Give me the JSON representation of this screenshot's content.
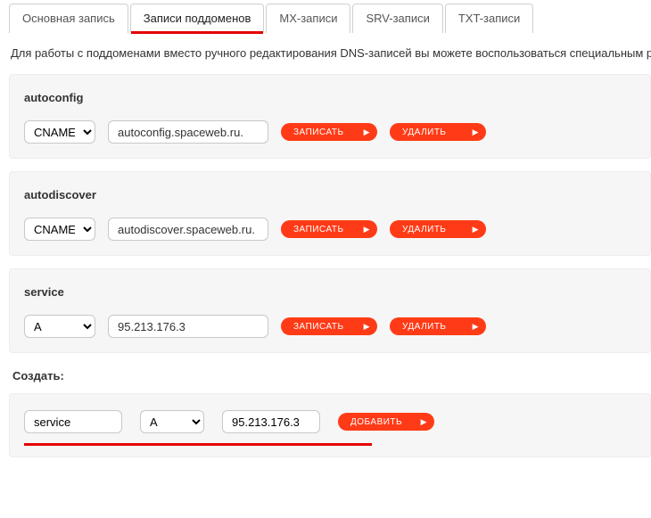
{
  "tabs": {
    "main": "Основная запись",
    "subdomains": "Записи поддоменов",
    "mx": "MX-записи",
    "srv": "SRV-записи",
    "txt": "TXT-записи"
  },
  "description": "Для работы с поддоменами вместо ручного редактирования DNS-записей вы можете воспользоваться специальным ра",
  "buttons": {
    "save": "ЗАПИСАТЬ",
    "delete": "УДАЛИТЬ",
    "add": "ДОБАВИТЬ"
  },
  "record_types": [
    "A",
    "CNAME"
  ],
  "records": [
    {
      "name": "autoconfig",
      "type": "CNAME",
      "value": "autoconfig.spaceweb.ru."
    },
    {
      "name": "autodiscover",
      "type": "CNAME",
      "value": "autodiscover.spaceweb.ru."
    },
    {
      "name": "service",
      "type": "A",
      "value": "95.213.176.3"
    }
  ],
  "create_label": "Создать:",
  "create": {
    "name": "service",
    "type": "A",
    "value": "95.213.176.3"
  }
}
